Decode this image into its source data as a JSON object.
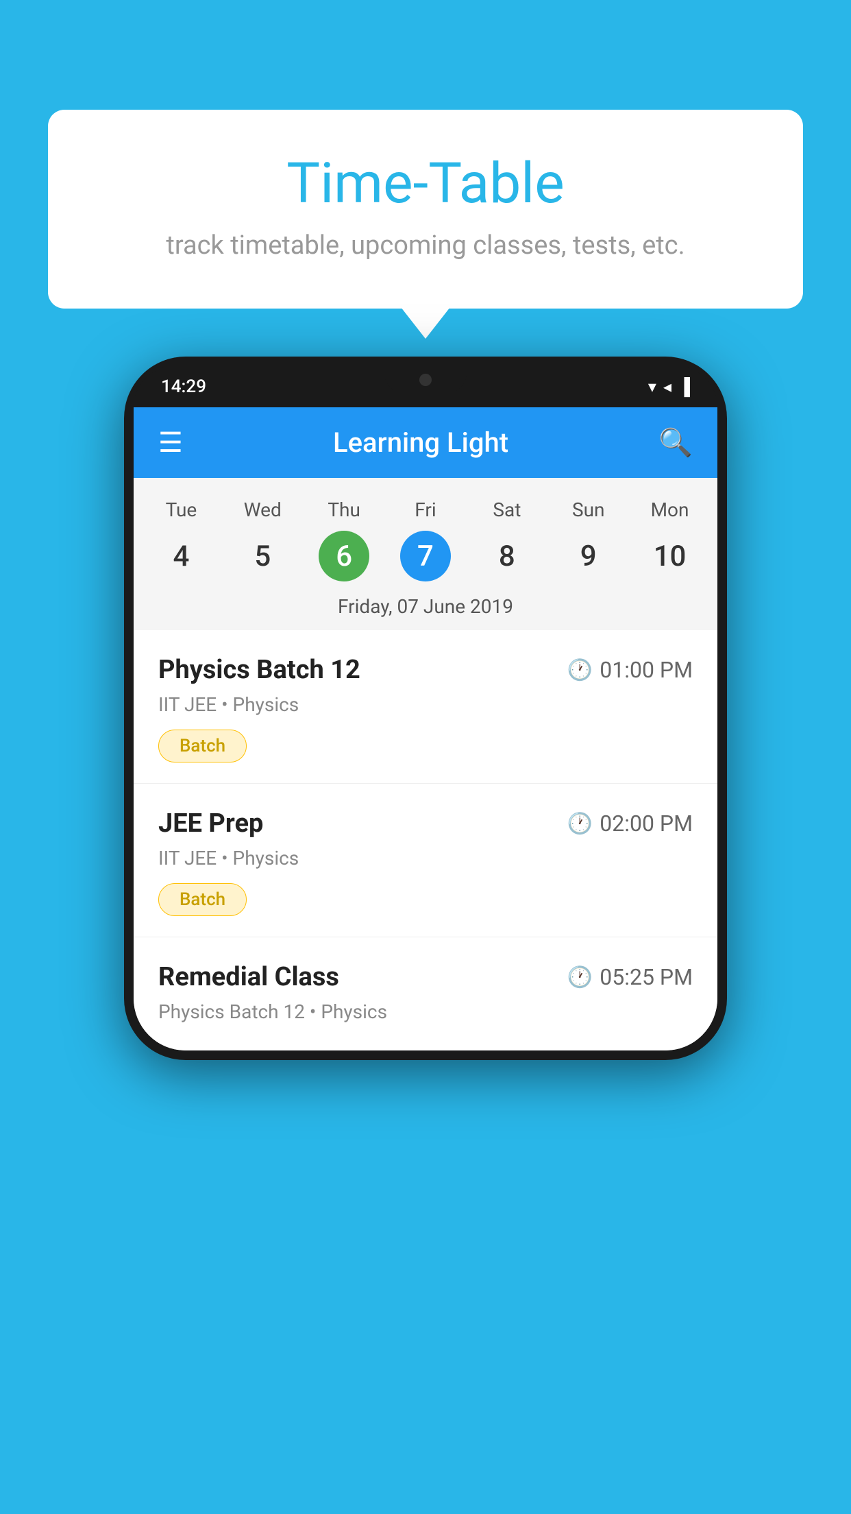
{
  "page": {
    "background_color": "#29b6e8"
  },
  "tooltip": {
    "title": "Time-Table",
    "subtitle": "track timetable, upcoming classes, tests, etc."
  },
  "phone": {
    "status_bar": {
      "time": "14:29",
      "wifi": "▼",
      "signal": "▲",
      "battery": "▐"
    },
    "app_bar": {
      "title": "Learning Light",
      "menu_icon": "≡",
      "search_icon": "🔍"
    },
    "calendar": {
      "days": [
        "Tue",
        "Wed",
        "Thu",
        "Fri",
        "Sat",
        "Sun",
        "Mon"
      ],
      "dates": [
        "4",
        "5",
        "6",
        "7",
        "8",
        "9",
        "10"
      ],
      "today_index": 2,
      "selected_index": 3,
      "selected_date_label": "Friday, 07 June 2019"
    },
    "classes": [
      {
        "name": "Physics Batch 12",
        "time": "01:00 PM",
        "meta": "IIT JEE • Physics",
        "tag": "Batch"
      },
      {
        "name": "JEE Prep",
        "time": "02:00 PM",
        "meta": "IIT JEE • Physics",
        "tag": "Batch"
      },
      {
        "name": "Remedial Class",
        "time": "05:25 PM",
        "meta": "Physics Batch 12 • Physics",
        "tag": null
      }
    ]
  }
}
